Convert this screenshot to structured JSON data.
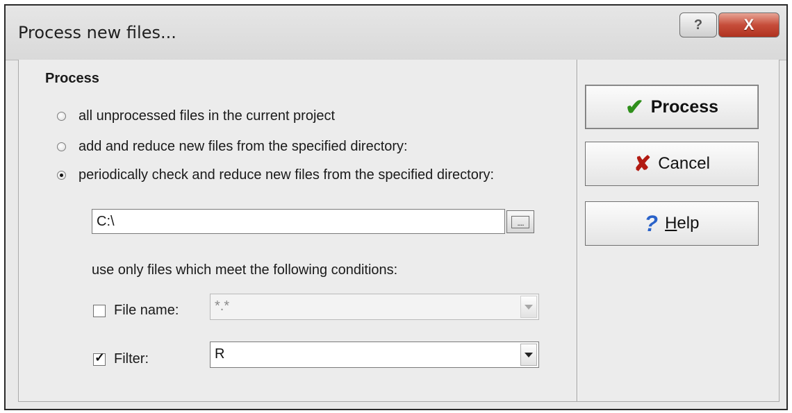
{
  "window": {
    "title": "Process new files...",
    "help_glyph": "?",
    "close_glyph": "X"
  },
  "process_section": {
    "label": "Process",
    "options": [
      {
        "label": "all unprocessed files in the current project",
        "checked": false
      },
      {
        "label": "add and reduce new files from the specified directory:",
        "checked": false
      },
      {
        "label": "periodically check and reduce new files from the specified directory:",
        "checked": true
      }
    ],
    "directory": {
      "value": "C:\\",
      "browse_label": "...."
    },
    "conditions_label": "use only files which meet the following conditions:",
    "file_name": {
      "label": "File name:",
      "checked": false,
      "value": "*.*",
      "enabled": false
    },
    "filter": {
      "label": "Filter:",
      "checked": true,
      "value": "R",
      "enabled": true
    }
  },
  "buttons": {
    "process": {
      "label": "Process",
      "icon": "checkmark-icon",
      "icon_color": "#2f8f1b"
    },
    "cancel": {
      "label": "Cancel",
      "icon": "x-icon",
      "icon_color": "#b21a12"
    },
    "help": {
      "label": "Help",
      "icon": "question-icon",
      "icon_color": "#2a62c9"
    }
  }
}
